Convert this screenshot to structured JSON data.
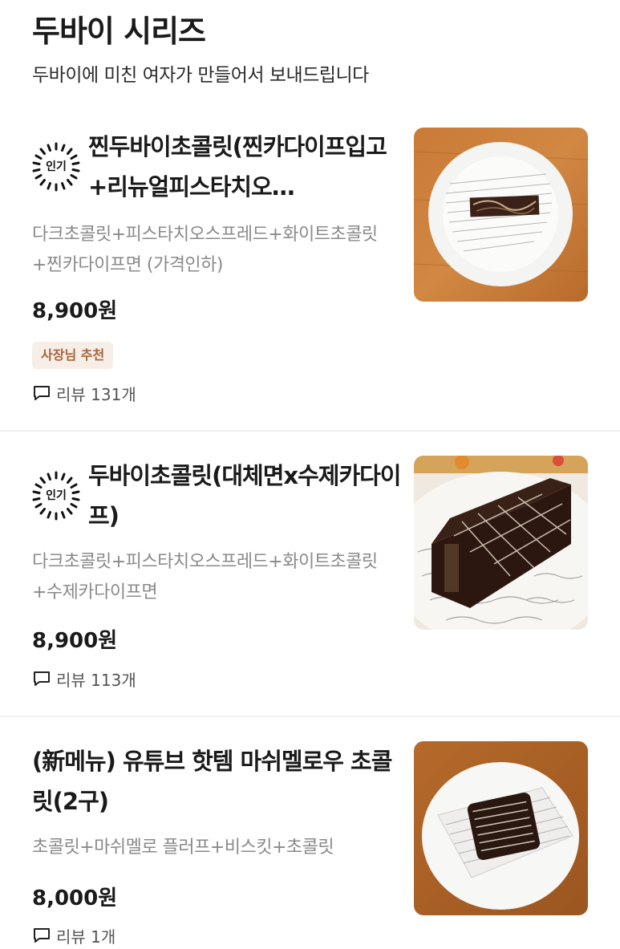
{
  "header": {
    "title": "두바이 시리즈",
    "subtitle": "두바이에 미친 여자가 만들어서 보내드립니다"
  },
  "items": [
    {
      "badge": "인기",
      "name": "찐두바이초콜릿(찐카다이프입고+리뉴얼피스타치오…",
      "description": "다크초콜릿+피스타치오스프레드+화이트초콜릿+찐카다이프면 (가격인하)",
      "price": "8,900원",
      "tag": "사장님 추천",
      "review": "리뷰 131개"
    },
    {
      "badge": "인기",
      "name": "두바이초콜릿(대체면x수제카다이프)",
      "description": "다크초콜릿+피스타치오스프레드+화이트초콜릿+수제카다이프면",
      "price": "8,900원",
      "review": "리뷰 113개"
    },
    {
      "name": "(新메뉴) 유튜브 핫템 마쉬멜로우 초콜릿(2구)",
      "description": "초콜릿+마쉬멜로 플러프+비스킷+초콜릿",
      "price": "8,000원",
      "review": "리뷰 1개"
    }
  ],
  "colors": {
    "tag_bg": "#f6eee7",
    "tag_text": "#a8643a",
    "desc_text": "#8a8a8a",
    "divider": "#f0f0f0"
  },
  "icons": {
    "review": "speech-bubble-icon",
    "badge": "popular-starburst-icon"
  }
}
